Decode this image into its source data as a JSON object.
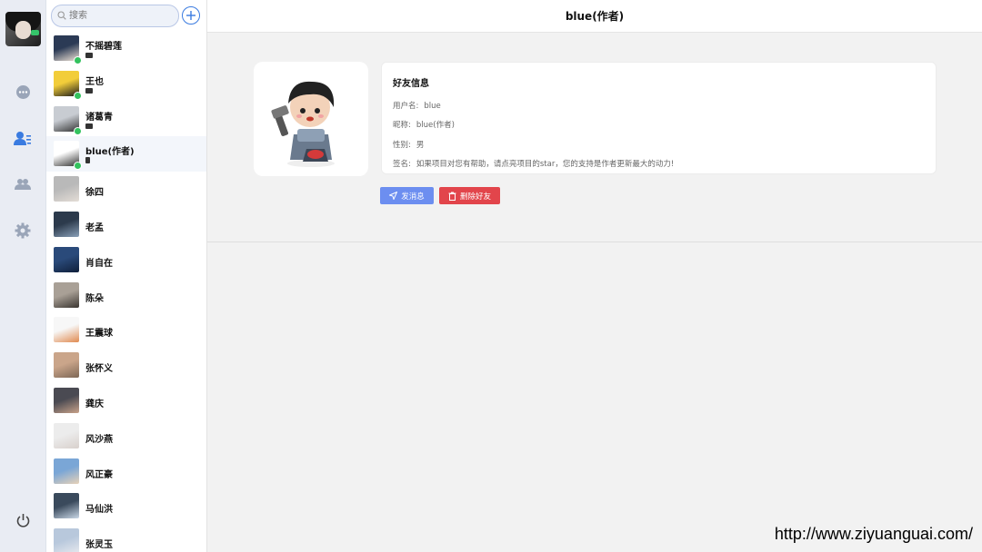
{
  "app": {
    "title": "blue(作者)"
  },
  "nav": {
    "items": [
      "chat-icon",
      "contacts-icon",
      "group-icon",
      "gear-icon",
      "power-icon"
    ],
    "active": "contacts-icon"
  },
  "search": {
    "placeholder": "搜索"
  },
  "friends": [
    {
      "name": "不摇碧莲",
      "online": true,
      "device": "pc"
    },
    {
      "name": "王也",
      "online": true,
      "device": "pc"
    },
    {
      "name": "诸葛青",
      "online": true,
      "device": "pc"
    },
    {
      "name": "blue(作者)",
      "online": true,
      "device": "phone",
      "active": true
    },
    {
      "name": "徐四"
    },
    {
      "name": "老孟"
    },
    {
      "name": "肖自在"
    },
    {
      "name": "陈朵"
    },
    {
      "name": "王震球"
    },
    {
      "name": "张怀义"
    },
    {
      "name": "龚庆"
    },
    {
      "name": "风沙燕"
    },
    {
      "name": "风正豪"
    },
    {
      "name": "马仙洪"
    },
    {
      "name": "张灵玉"
    }
  ],
  "profile": {
    "section_title": "好友信息",
    "username_label": "用户名:",
    "username": "blue",
    "nickname_label": "昵称:",
    "nickname": "blue(作者)",
    "gender_label": "性别:",
    "gender": "男",
    "signature_label": "签名:",
    "signature": "如果项目对您有帮助，请点亮项目的star，您的支持是作者更新最大的动力!"
  },
  "actions": {
    "send_label": "发消息",
    "delete_label": "删除好友"
  },
  "colors": {
    "send": "#6c8ef0",
    "delete": "#e2454b",
    "online": "#33c25e",
    "accent": "#3a7be0"
  },
  "watermark": "http://www.ziyuanguai.com/"
}
